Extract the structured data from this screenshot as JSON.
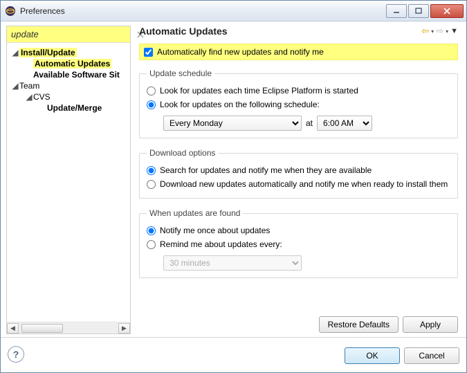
{
  "window": {
    "title": "Preferences"
  },
  "filter": {
    "value": "update"
  },
  "tree": {
    "install_update": "Install/Update",
    "automatic_updates": "Automatic Updates",
    "available_software": "Available Software Sit",
    "team": "Team",
    "cvs": "CVS",
    "update_merge": "Update/Merge"
  },
  "page": {
    "heading": "Automatic Updates",
    "enable_label": "Automatically find new updates and notify me",
    "schedule_legend": "Update schedule",
    "schedule_opt1": "Look for updates each time Eclipse Platform is started",
    "schedule_opt2": "Look for updates on the following schedule:",
    "schedule_day": "Every Monday",
    "schedule_at": "at",
    "schedule_time": "6:00 AM",
    "download_legend": "Download options",
    "download_opt1": "Search for updates and notify me when they are available",
    "download_opt2": "Download new updates automatically and notify me when ready to install them",
    "found_legend": "When updates are found",
    "found_opt1": "Notify me once about updates",
    "found_opt2": "Remind me about updates every:",
    "remind_interval": "30 minutes",
    "restore_defaults": "Restore Defaults",
    "apply": "Apply"
  },
  "footer": {
    "ok": "OK",
    "cancel": "Cancel"
  }
}
